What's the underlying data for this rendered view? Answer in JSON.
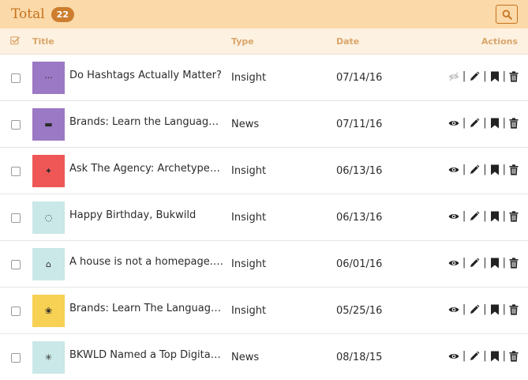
{
  "header": {
    "title": "Total",
    "count": "22",
    "search_icon": "search-icon"
  },
  "columns": {
    "select_icon": "checkbox-checked-icon",
    "title": "Title",
    "type": "Type",
    "date": "Date",
    "actions": "Actions"
  },
  "colors": {
    "topbar_bg": "#fbd9a8",
    "accent": "#c4721d",
    "header_bg": "#fdf1e1"
  },
  "rows": [
    {
      "title": "Do Hashtags Actually Matter?",
      "type": "Insight",
      "date": "07/14/16",
      "thumb_color": "#9b79c4",
      "thumb_glyph": "···",
      "visibility": "hidden"
    },
    {
      "title": "Brands: Learn the Language to...",
      "type": "News",
      "date": "07/11/16",
      "thumb_color": "#9b79c4",
      "thumb_glyph": "▬",
      "visibility": "visible"
    },
    {
      "title": "Ask The Agency: Archetypes & ...",
      "type": "Insight",
      "date": "06/13/16",
      "thumb_color": "#ef5757",
      "thumb_glyph": "✦",
      "visibility": "visible"
    },
    {
      "title": "Happy Birthday, Bukwild",
      "type": "Insight",
      "date": "06/13/16",
      "thumb_color": "#c9e8e7",
      "thumb_glyph": "◌",
      "visibility": "visible"
    },
    {
      "title": "A house is not a homepage...or...",
      "type": "Insight",
      "date": "06/01/16",
      "thumb_color": "#c9e8e7",
      "thumb_glyph": "⌂",
      "visibility": "visible"
    },
    {
      "title": "Brands: Learn The Language to...",
      "type": "Insight",
      "date": "05/25/16",
      "thumb_color": "#f7d154",
      "thumb_glyph": "❀",
      "visibility": "visible"
    },
    {
      "title": "BKWLD Named a Top Digital ...",
      "type": "News",
      "date": "08/18/15",
      "thumb_color": "#c9e8e7",
      "thumb_glyph": "✳",
      "visibility": "visible"
    }
  ]
}
